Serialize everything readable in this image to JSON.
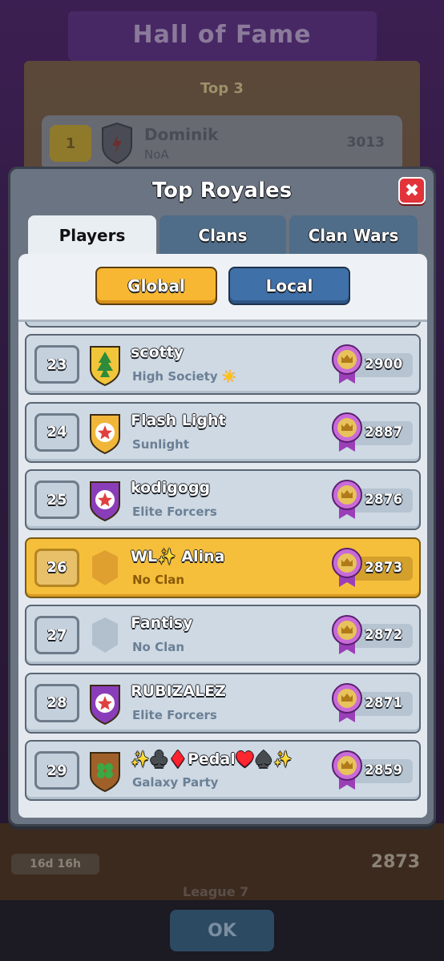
{
  "background": {
    "title": "Hall of Fame",
    "top3_label": "Top 3",
    "top_player": {
      "rank": "1",
      "name": "Dominik",
      "clan": "NoA",
      "trophies": "3013"
    },
    "timer": "16d 16h",
    "score": "2873",
    "league": "League 7",
    "ok_label": "OK"
  },
  "modal": {
    "title": "Top Royales",
    "close_label": "✖",
    "tabs": [
      {
        "label": "Players",
        "active": true
      },
      {
        "label": "Clans",
        "active": false
      },
      {
        "label": "Clan Wars",
        "active": false
      }
    ],
    "segment": {
      "global_label": "Global",
      "local_label": "Local",
      "selected": "Global"
    }
  },
  "players": [
    {
      "rank": "23",
      "name": "scotty",
      "clan": "High Society ☀️",
      "trophies": "2900",
      "badge_color": "#f0c53a",
      "badge_icon": "tree-icon",
      "me": false
    },
    {
      "rank": "24",
      "name": "Flash Light",
      "clan": "Sunlight",
      "trophies": "2887",
      "badge_color": "#f0b63a",
      "badge_icon": "star-icon",
      "me": false
    },
    {
      "rank": "25",
      "name": "kodigogg",
      "clan": "Elite Forcers",
      "trophies": "2876",
      "badge_color": "#8a3db8",
      "badge_icon": "star-icon",
      "me": false
    },
    {
      "rank": "26",
      "name": "WL✨ Alina",
      "clan": "No Clan",
      "trophies": "2873",
      "badge_color": "#e0a030",
      "badge_icon": "empty-badge-icon",
      "me": true
    },
    {
      "rank": "27",
      "name": "Fantisy",
      "clan": "No Clan",
      "trophies": "2872",
      "badge_color": "#b2bfcd",
      "badge_icon": "empty-badge-icon",
      "me": false
    },
    {
      "rank": "28",
      "name": "RUBIZALEZ",
      "clan": "Elite Forcers",
      "trophies": "2871",
      "badge_color": "#8a3db8",
      "badge_icon": "star-icon",
      "me": false
    },
    {
      "rank": "29",
      "name": "✨♣️♦️Pedal♥️♠️✨",
      "clan": "Galaxy Party",
      "trophies": "2859",
      "badge_color": "#a0602a",
      "badge_icon": "clover-icon",
      "me": false
    }
  ]
}
